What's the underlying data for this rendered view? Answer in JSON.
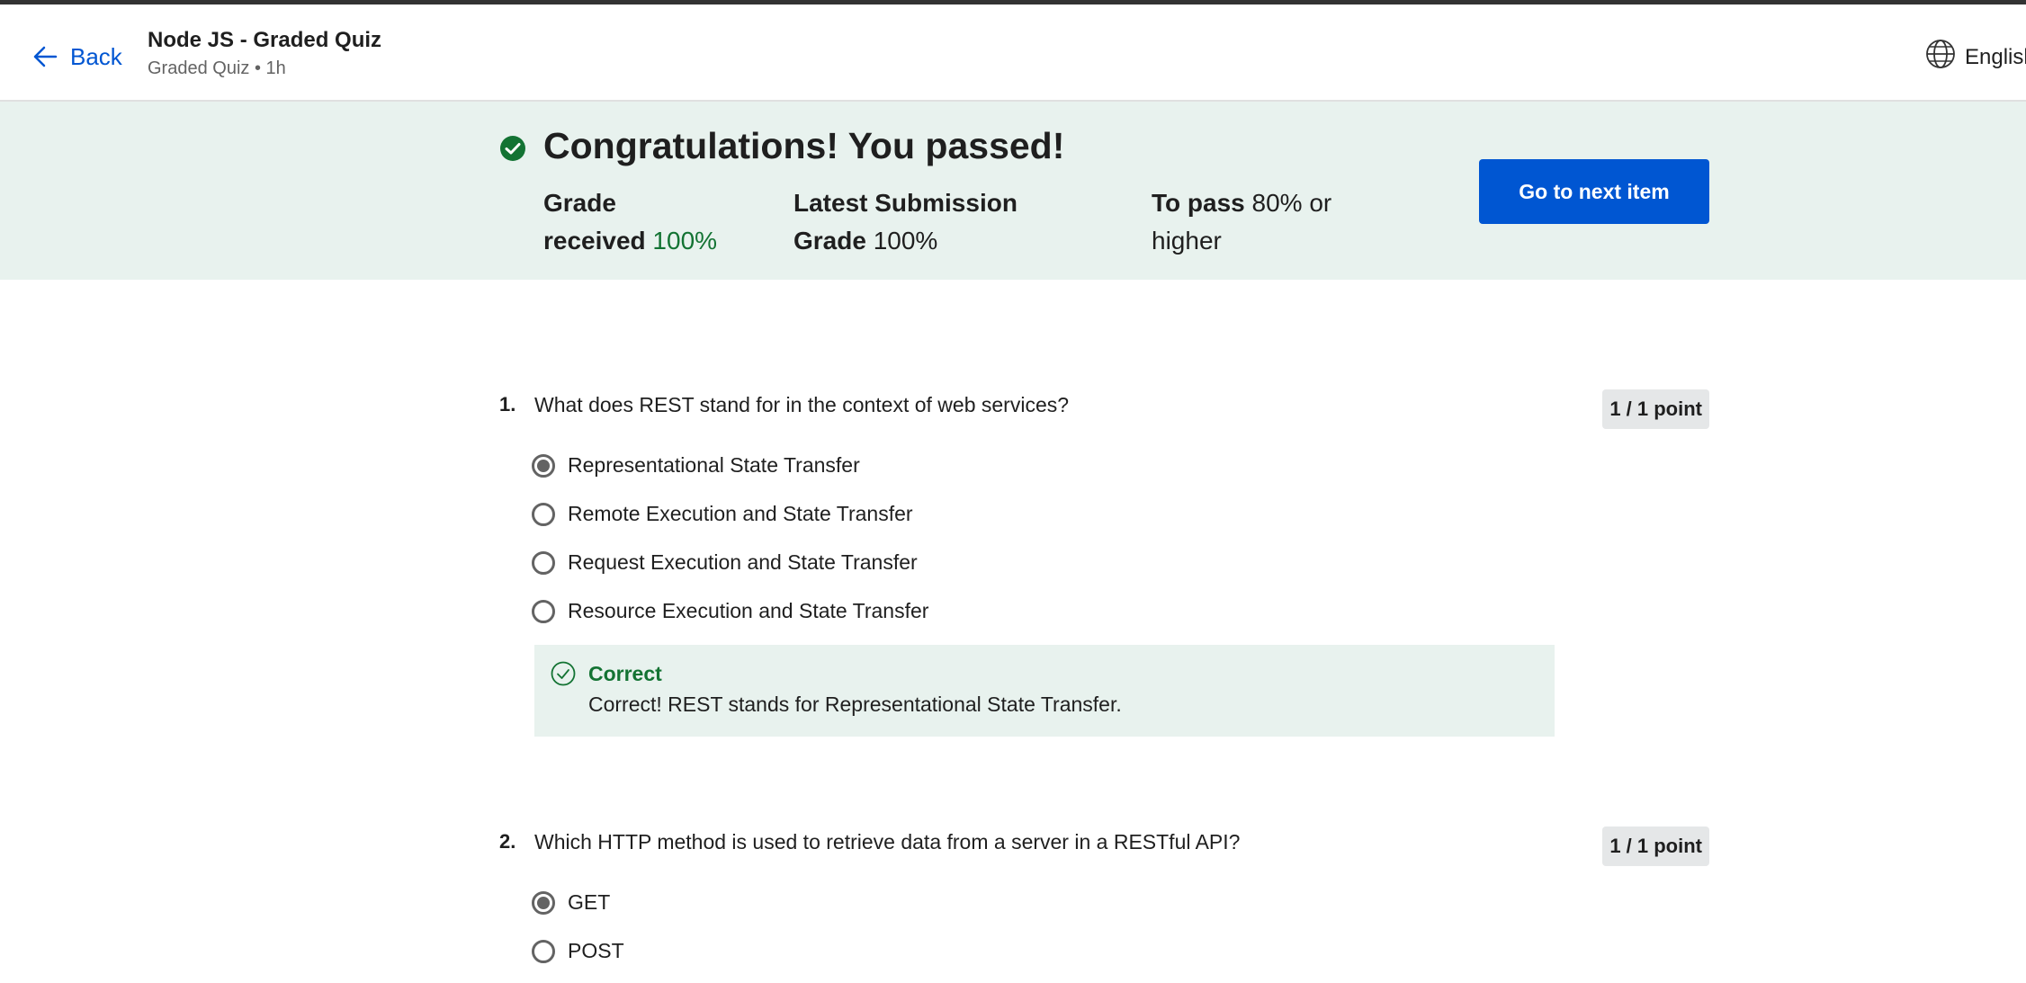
{
  "header": {
    "back_label": "Back",
    "course_title": "Node JS - Graded Quiz",
    "course_sub": "Graded Quiz • 1h",
    "language": "English"
  },
  "banner": {
    "title": "Congratulations! You passed!",
    "grade_label_1": "Grade",
    "grade_label_2": "received",
    "grade_value": "100%",
    "latest_label_1": "Latest Submission",
    "latest_label_2": "Grade",
    "latest_value": "100%",
    "pass_label": "To pass",
    "pass_value_1": "80% or",
    "pass_value_2": "higher",
    "next_button": "Go to next item"
  },
  "questions": [
    {
      "number": "1.",
      "text": "What does REST stand for in the context of web services?",
      "points": "1 / 1 point",
      "options": [
        {
          "label": "Representational State Transfer",
          "selected": true
        },
        {
          "label": "Remote Execution and State Transfer",
          "selected": false
        },
        {
          "label": "Request Execution and State Transfer",
          "selected": false
        },
        {
          "label": "Resource Execution and State Transfer",
          "selected": false
        }
      ],
      "feedback": {
        "status": "Correct",
        "text": "Correct! REST stands for Representational State Transfer."
      }
    },
    {
      "number": "2.",
      "text": "Which HTTP method is used to retrieve data from a server in a RESTful API?",
      "points": "1 / 1 point",
      "options": [
        {
          "label": "GET",
          "selected": true
        },
        {
          "label": "POST",
          "selected": false
        }
      ]
    }
  ],
  "colors": {
    "brand_blue": "#0056d2",
    "success_green": "#137333",
    "banner_bg": "#e8f2ee"
  }
}
